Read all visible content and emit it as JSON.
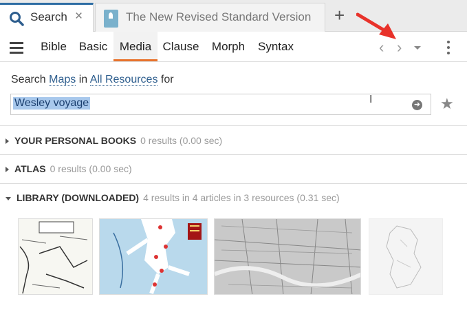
{
  "tabs": {
    "search_label": "Search",
    "bible_label": "The New Revised Standard Version",
    "close_glyph": "×",
    "add_glyph": "+"
  },
  "toolbar": {
    "tabs": [
      "Bible",
      "Basic",
      "Media",
      "Clause",
      "Morph",
      "Syntax"
    ],
    "active_tab": "Media",
    "back_glyph": "‹",
    "forward_glyph": "›"
  },
  "search": {
    "prefix": "Search",
    "scope": "Maps",
    "in_word": "in",
    "collection": "All Resources",
    "for_word": "for",
    "query": "Wesley voyage",
    "go_glyph": "➜",
    "star_glyph": "★"
  },
  "sections": [
    {
      "title": "YOUR PERSONAL BOOKS",
      "results": "0 results (0.00 sec)",
      "expanded": false
    },
    {
      "title": "ATLAS",
      "results": "0 results (0.00 sec)",
      "expanded": false
    },
    {
      "title": "LIBRARY (DOWNLOADED)",
      "results": "4 results in 4 articles in 3 resources (0.31 sec)",
      "expanded": true
    }
  ],
  "thumbnails": [
    "map-thumbnail",
    "map-thumbnail",
    "map-thumbnail",
    "map-thumbnail"
  ],
  "colors": {
    "accent": "#e8732c",
    "link": "#2e5e8e",
    "selection": "#a8c8ec",
    "annotation_arrow": "#e8322a"
  }
}
